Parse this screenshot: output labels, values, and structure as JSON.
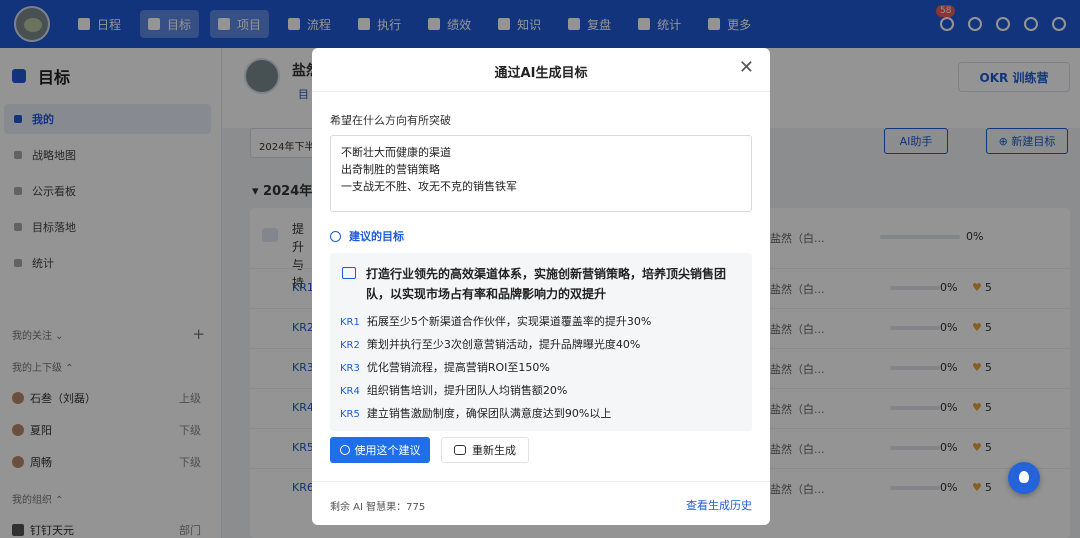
{
  "topnav": {
    "items": [
      {
        "label": "日程",
        "icon": "calendar-icon",
        "active": false
      },
      {
        "label": "目标",
        "icon": "target-icon",
        "active": true
      },
      {
        "label": "项目",
        "icon": "cube-icon",
        "active": true
      },
      {
        "label": "流程",
        "icon": "flow-icon",
        "active": false
      },
      {
        "label": "执行",
        "icon": "checklist-icon",
        "active": false
      },
      {
        "label": "绩效",
        "icon": "chart-icon",
        "active": false
      },
      {
        "label": "知识",
        "icon": "book-icon",
        "active": false
      },
      {
        "label": "复盘",
        "icon": "review-icon",
        "active": false
      },
      {
        "label": "统计",
        "icon": "pie-icon",
        "active": false
      },
      {
        "label": "更多",
        "icon": "grid-icon",
        "active": false
      }
    ],
    "notification_count": "58"
  },
  "sidebar": {
    "title": "目标",
    "items": [
      {
        "label": "我的",
        "active": true
      },
      {
        "label": "战略地图",
        "active": false
      },
      {
        "label": "公示看板",
        "active": false
      },
      {
        "label": "目标落地",
        "active": false
      },
      {
        "label": "统计",
        "active": false
      }
    ],
    "follow_label": "我的关注 ⌄",
    "follow_add": "+",
    "superiors_label": "我的上下级 ⌃",
    "people": [
      {
        "name": "石叁（刘磊）",
        "rel": "上级"
      },
      {
        "name": "夏阳",
        "rel": "下级"
      },
      {
        "name": "周畅",
        "rel": "下级"
      }
    ],
    "org_label": "我的组织 ⌃",
    "org_item": {
      "name": "钉钉天元",
      "rel": "部门"
    }
  },
  "main": {
    "user_name": "盐然",
    "tab": "目",
    "okr_label": "OKR 训练营",
    "filter": "2024年下半",
    "ai_help": "AI助手",
    "new_goal": "⊕ 新建目标",
    "year": "▾ 2024年",
    "goal_title": "提升\n与持",
    "goal_owner": "盐然（白...",
    "goal_pct": "0%",
    "rows": [
      {
        "kr": "KR1",
        "owner": "盐然（白...",
        "pct": "0%",
        "score": "5"
      },
      {
        "kr": "KR2",
        "owner": "盐然（白...",
        "pct": "0%",
        "score": "5"
      },
      {
        "kr": "KR3",
        "owner": "盐然（白...",
        "pct": "0%",
        "score": "5"
      },
      {
        "kr": "KR4",
        "owner": "盐然（白...",
        "pct": "0%",
        "score": "5"
      },
      {
        "kr": "KR5",
        "owner": "盐然（白...",
        "pct": "0%",
        "score": "5"
      },
      {
        "kr": "KR6",
        "owner": "盐然（白...",
        "pct": "0%",
        "score": "5"
      }
    ]
  },
  "modal": {
    "title": "通过AI生成目标",
    "close": "✕",
    "prompt_label": "希望在什么方向有所突破",
    "prompt_lines": [
      "不断壮大而健康的渠道",
      "出奇制胜的营销策略",
      "一支战无不胜、攻无不克的销售铁军"
    ],
    "suggest_label": "建议的目标",
    "goal": "打造行业领先的高效渠道体系，实施创新营销策略，培养顶尖销售团队，以实现市场占有率和品牌影响力的双提升",
    "krs": [
      {
        "k": "KR1",
        "text": "拓展至少5个新渠道合作伙伴，实现渠道覆盖率的提升30%"
      },
      {
        "k": "KR2",
        "text": "策划并执行至少3次创意营销活动，提升品牌曝光度40%"
      },
      {
        "k": "KR3",
        "text": "优化营销流程，提高营销ROI至150%"
      },
      {
        "k": "KR4",
        "text": "组织销售培训，提升团队人均销售额20%"
      },
      {
        "k": "KR5",
        "text": "建立销售激励制度，确保团队满意度达到90%以上"
      }
    ],
    "use_label": "使用这个建议",
    "regen_label": "重新生成",
    "remaining": "剩余 AI 智慧果：775",
    "history": "查看生成历史"
  },
  "colors": {
    "brand": "#1f5bd8",
    "accent": "#1f6fe8",
    "heart": "#e8a13a"
  }
}
